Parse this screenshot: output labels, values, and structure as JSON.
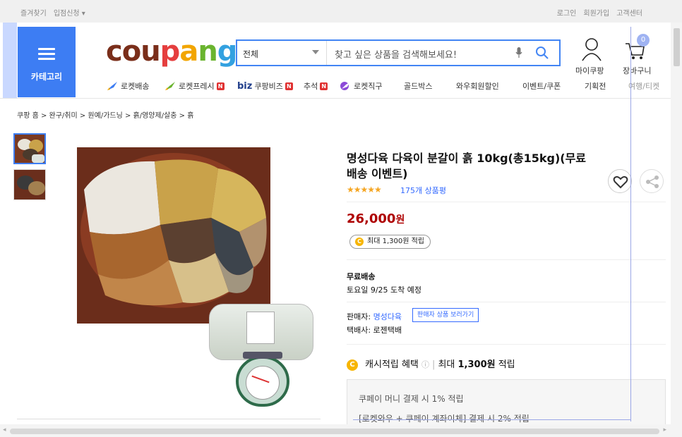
{
  "topbar": {
    "left": [
      "즐겨찾기",
      "입점신청 ▾"
    ],
    "right": [
      "로그인",
      "회원가입",
      "고객센터"
    ]
  },
  "category": {
    "label": "카테고리"
  },
  "logo": {
    "parts": [
      "cou",
      "p",
      "a",
      "n",
      "g"
    ]
  },
  "search": {
    "category": "전체",
    "placeholder": "찾고 싶은 상품을 검색해보세요!"
  },
  "header": {
    "mypage_label": "마이쿠팡",
    "cart_label": "장바구니",
    "cart_count": "0"
  },
  "nav": [
    {
      "label": "로켓배송",
      "icon": "rocket-icon"
    },
    {
      "label": "로켓프레시",
      "icon": "rocket-fresh-icon",
      "badge": "N"
    },
    {
      "label": "쿠팡비즈",
      "prefix": "biz",
      "badge": "N"
    },
    {
      "label": "추석",
      "badge": "N"
    },
    {
      "label": "로켓직구",
      "icon": "globe-rocket-icon"
    },
    {
      "label": "골드박스"
    },
    {
      "label": "와우회원할인"
    },
    {
      "label": "이벤트/쿠폰"
    },
    {
      "label": "기획전"
    },
    {
      "label": "여행/티켓"
    }
  ],
  "breadcrumb": "쿠팡 홈  >  완구/취미  >  원예/가드닝  >  흙/영양제/살충  >  흙",
  "product": {
    "title": "명성다육 다육이 분갈이 흙 10kg(총15kg)(무료배송 이벤트)",
    "stars": "★★★★★",
    "reviews": "175개 상품평",
    "price": "26,000",
    "price_unit": "원",
    "point": "최대 1,300원 적립",
    "shipping_title": "무료배송",
    "shipping_date": "토요일 9/25 도착 예정",
    "seller_prefix": "판매자: ",
    "seller_name": "명성다육",
    "seller_button": "판매자 상품 보러가기",
    "courier": "택배사: 로젠택배",
    "cash_label": "캐시적립 혜택",
    "cash_info": "ⓘ",
    "cash_value_prefix": "최대 ",
    "cash_value": "1,300원",
    "cash_value_suffix": " 적립",
    "benefit_1": "쿠페이 머니 결제 시 1% 적립",
    "benefit_2": "[로켓와우 + 쿠페이 계좌이체] 결제 시 2% 적립"
  },
  "colors": {
    "accent": "#3d7df3",
    "price": "#ae0000",
    "link": "#346aff",
    "star": "#f5a623"
  }
}
